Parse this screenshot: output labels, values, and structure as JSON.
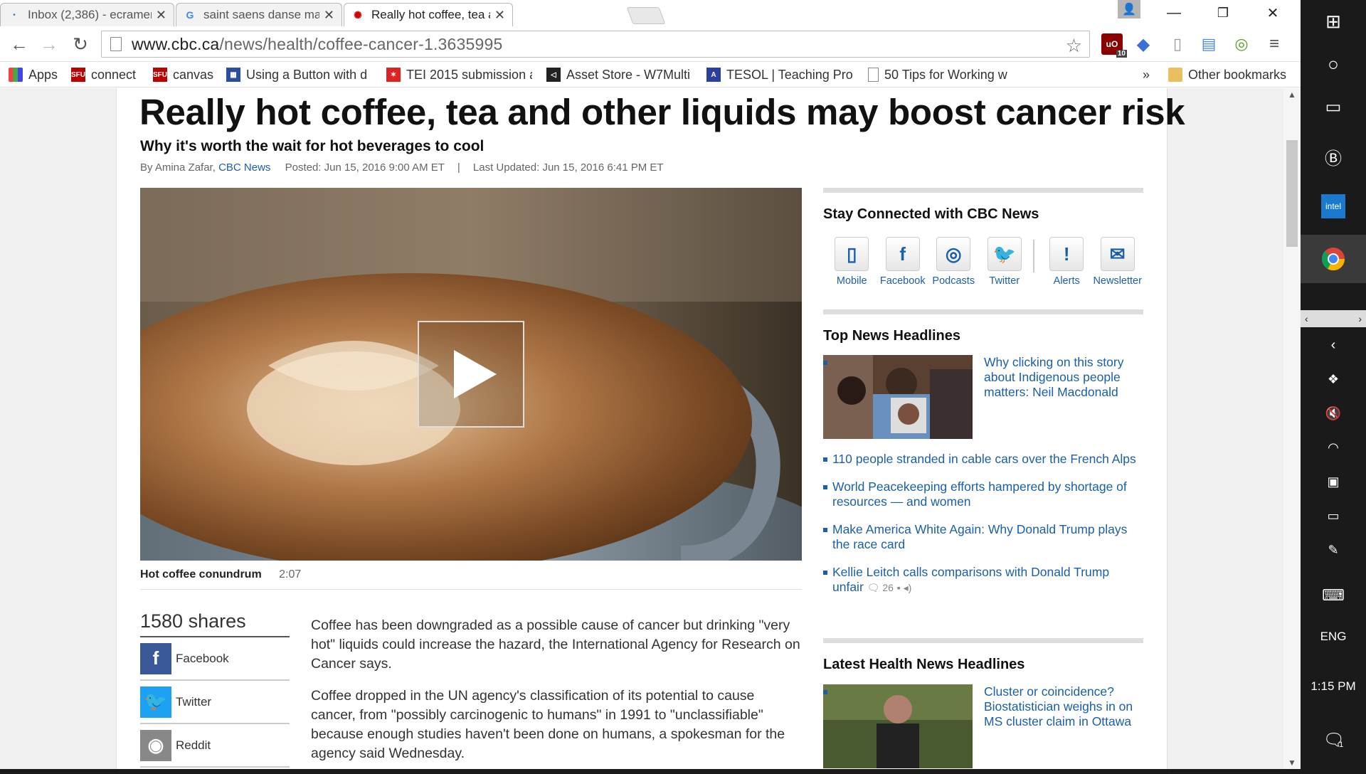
{
  "tabs": [
    {
      "title": "Inbox (2,386) - ecramer89",
      "icon": "gmail-icon"
    },
    {
      "title": "saint saens danse macabre",
      "icon": "google-icon"
    },
    {
      "title": "Really hot coffee, tea and",
      "icon": "cbc-icon"
    }
  ],
  "address": {
    "domain": "www.cbc.ca",
    "path": "/news/health/coffee-cancer-1.3635995"
  },
  "extensions": {
    "ublock_badge": "10"
  },
  "bookmarks": [
    {
      "label": "Apps",
      "icon": "apps-grid-icon"
    },
    {
      "label": "connect",
      "icon": "sfu-icon"
    },
    {
      "label": "canvas",
      "icon": "sfu-icon"
    },
    {
      "label": "Using a Button with d",
      "icon": "grid-icon"
    },
    {
      "label": "TEI 2015 submission a",
      "icon": "tei-icon"
    },
    {
      "label": "Asset Store - W7Multi",
      "icon": "unity-icon"
    },
    {
      "label": "TESOL | Teaching Pro",
      "icon": "tesol-icon"
    },
    {
      "label": "50 Tips for Working w",
      "icon": "page-icon"
    }
  ],
  "bookmarks_more": "»",
  "other_bookmarks": "Other bookmarks",
  "article": {
    "headline": "Really hot coffee, tea and other liquids may boost cancer risk",
    "subhead": "Why it's worth the wait for hot beverages to cool",
    "byline_prefix": "By Amina Zafar,",
    "byline_source": "CBC News",
    "posted": "Posted: Jun 15, 2016 9:00 AM ET",
    "byline_sep": "|",
    "updated": "Last Updated: Jun 15, 2016 6:41 PM ET",
    "video_caption": "Hot coffee conundrum",
    "video_duration": "2:07",
    "paragraphs": [
      "Coffee has been downgraded as a possible cause of cancer but drinking \"very hot\" liquids could increase the hazard, the International Agency for Research on Cancer says.",
      "Coffee dropped in the UN agency's classification of its potential to cause cancer, from \"possibly carcinogenic to humans\" in 1991 to \"unclassifiable\" because enough studies haven't been done on humans, a spokesman for the agency said Wednesday."
    ]
  },
  "shares": {
    "count": "1580 shares",
    "items": [
      {
        "label": "Facebook",
        "icon": "facebook-icon",
        "color": "#3b5998"
      },
      {
        "label": "Twitter",
        "icon": "twitter-icon",
        "color": "#1da1f2"
      },
      {
        "label": "Reddit",
        "icon": "reddit-icon",
        "color": "#888888"
      }
    ]
  },
  "stay_connected": {
    "title": "Stay Connected with CBC News",
    "items": [
      {
        "label": "Mobile",
        "icon": "mobile-icon"
      },
      {
        "label": "Facebook",
        "icon": "facebook-icon"
      },
      {
        "label": "Podcasts",
        "icon": "podcast-icon"
      },
      {
        "label": "Twitter",
        "icon": "twitter-icon"
      },
      {
        "label": "Alerts",
        "icon": "alert-icon"
      },
      {
        "label": "Newsletter",
        "icon": "envelope-icon"
      }
    ]
  },
  "top_news": {
    "title": "Top News Headlines",
    "featured": "Why clicking on this story about Indigenous people matters: Neil Macdonald",
    "items": [
      "110 people stranded in cable cars over the French Alps",
      "World Peacekeeping efforts hampered by shortage of resources — and women",
      "Make America White Again: Why Donald Trump plays the race card",
      "Kellie Leitch calls comparisons with Donald Trump unfair"
    ],
    "comment_count": "26"
  },
  "health_news": {
    "title": "Latest Health News Headlines",
    "featured": "Cluster or coincidence? Biostatistician weighs in on MS cluster claim in Ottawa"
  },
  "system": {
    "language": "ENG",
    "time": "1:15 PM",
    "notifications": "1"
  },
  "colors": {
    "link": "#1a5fa8",
    "taskbar": "#1a1a1a"
  }
}
